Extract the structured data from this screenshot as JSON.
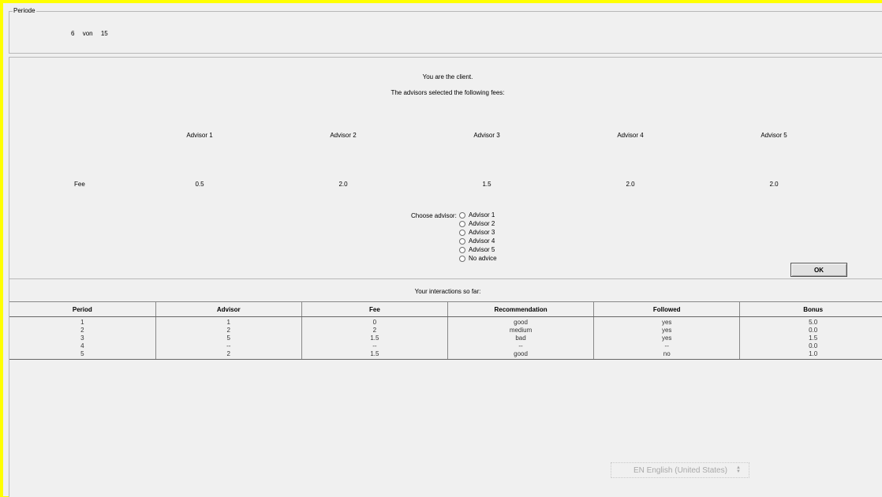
{
  "periode": {
    "legend": "Periode",
    "current": "6",
    "separator": "von",
    "total": "15"
  },
  "main": {
    "role_text": "You are the client.",
    "fees_intro": "The advisors selected the following fees:",
    "fee_row_label": "Fee",
    "advisors": [
      {
        "label": "Advisor 1",
        "fee": "0.5"
      },
      {
        "label": "Advisor 2",
        "fee": "2.0"
      },
      {
        "label": "Advisor 3",
        "fee": "1.5"
      },
      {
        "label": "Advisor 4",
        "fee": "2.0"
      },
      {
        "label": "Advisor 5",
        "fee": "2.0"
      }
    ],
    "choose_label": "Choose advisor:",
    "options": [
      "Advisor 1",
      "Advisor 2",
      "Advisor 3",
      "Advisor 4",
      "Advisor 5",
      "No advice"
    ],
    "ok_label": "OK"
  },
  "history": {
    "title": "Your interactions so far:",
    "columns": [
      "Period",
      "Advisor",
      "Fee",
      "Recommendation",
      "Followed",
      "Bonus"
    ],
    "rows": [
      [
        "1",
        "1",
        "0",
        "good",
        "yes",
        "5.0"
      ],
      [
        "2",
        "2",
        "2",
        "medium",
        "yes",
        "0.0"
      ],
      [
        "3",
        "5",
        "1.5",
        "bad",
        "yes",
        "1.5"
      ],
      [
        "4",
        "--",
        "--",
        "--",
        "--",
        "0.0"
      ],
      [
        "5",
        "2",
        "1.5",
        "good",
        "no",
        "1.0"
      ]
    ]
  },
  "language": {
    "value": "EN English (United States)"
  },
  "colors": {
    "frame": "#ffff00",
    "background": "#f0f0f0"
  }
}
